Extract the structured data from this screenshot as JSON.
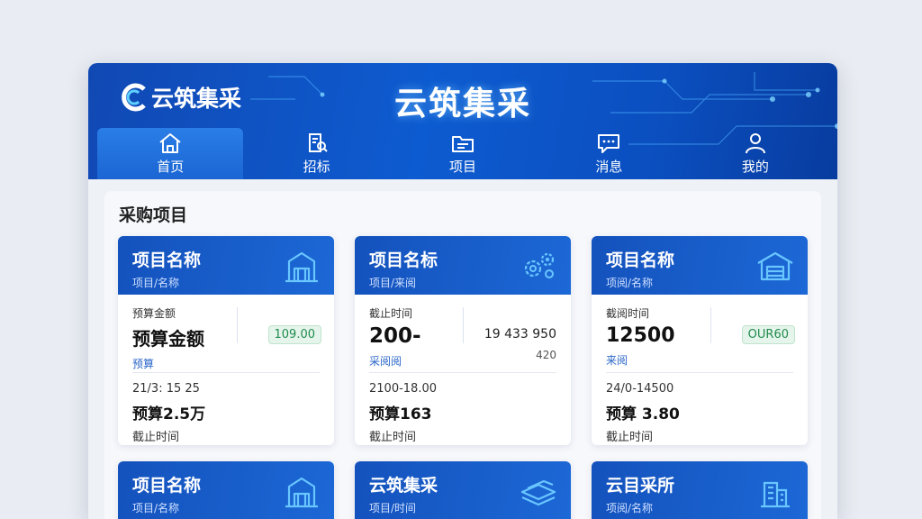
{
  "app": {
    "logo_text": "云筑集采",
    "title": "云筑集采"
  },
  "nav": [
    {
      "label": "首页",
      "icon": "home-icon",
      "active": true
    },
    {
      "label": "招标",
      "icon": "document-search-icon",
      "active": false
    },
    {
      "label": "项目",
      "icon": "folder-icon",
      "active": false
    },
    {
      "label": "消息",
      "icon": "message-icon",
      "active": false
    },
    {
      "label": "我的",
      "icon": "user-icon",
      "active": false
    }
  ],
  "section": {
    "title": "采购项目"
  },
  "cards": [
    {
      "title": "项目名称",
      "subtitle": "项目/名称",
      "icon": "building-icon",
      "label": "预算金额",
      "value": "预算金额",
      "blue": "预算",
      "badge": "109.00",
      "date": "21/3: 15 25",
      "amount": "预算2.5万",
      "foot_label": "截止时间"
    },
    {
      "title": "项目名标",
      "subtitle": "项目/来阅",
      "icon": "gears-icon",
      "label": "截止时间",
      "value": "200-",
      "blue": "采阅阅",
      "right_top": "19 433   950",
      "right_bottom": "420",
      "date": "2100-18.00",
      "amount": "预算163",
      "foot_label": "截止时间"
    },
    {
      "title": "项目名称",
      "subtitle": "项阅/名称",
      "icon": "warehouse-icon",
      "label": "截阅时间",
      "value": "12500",
      "blue": "来阅",
      "badge": "OUR60",
      "date": "24/0-14500",
      "amount": "预算 3.80",
      "foot_label": "截止时间"
    },
    {
      "title": "项目名称",
      "subtitle": "项目/名称",
      "icon": "building-icon"
    },
    {
      "title": "云筑集采",
      "subtitle": "项目/时间",
      "icon": "stack-icon"
    },
    {
      "title": "云目采所",
      "subtitle": "项阅/名称",
      "icon": "office-icon"
    }
  ],
  "colors": {
    "brand_blue": "#0d5bd0",
    "accent_cyan": "#5fd0ff",
    "badge_green": "#1f8b4c"
  }
}
